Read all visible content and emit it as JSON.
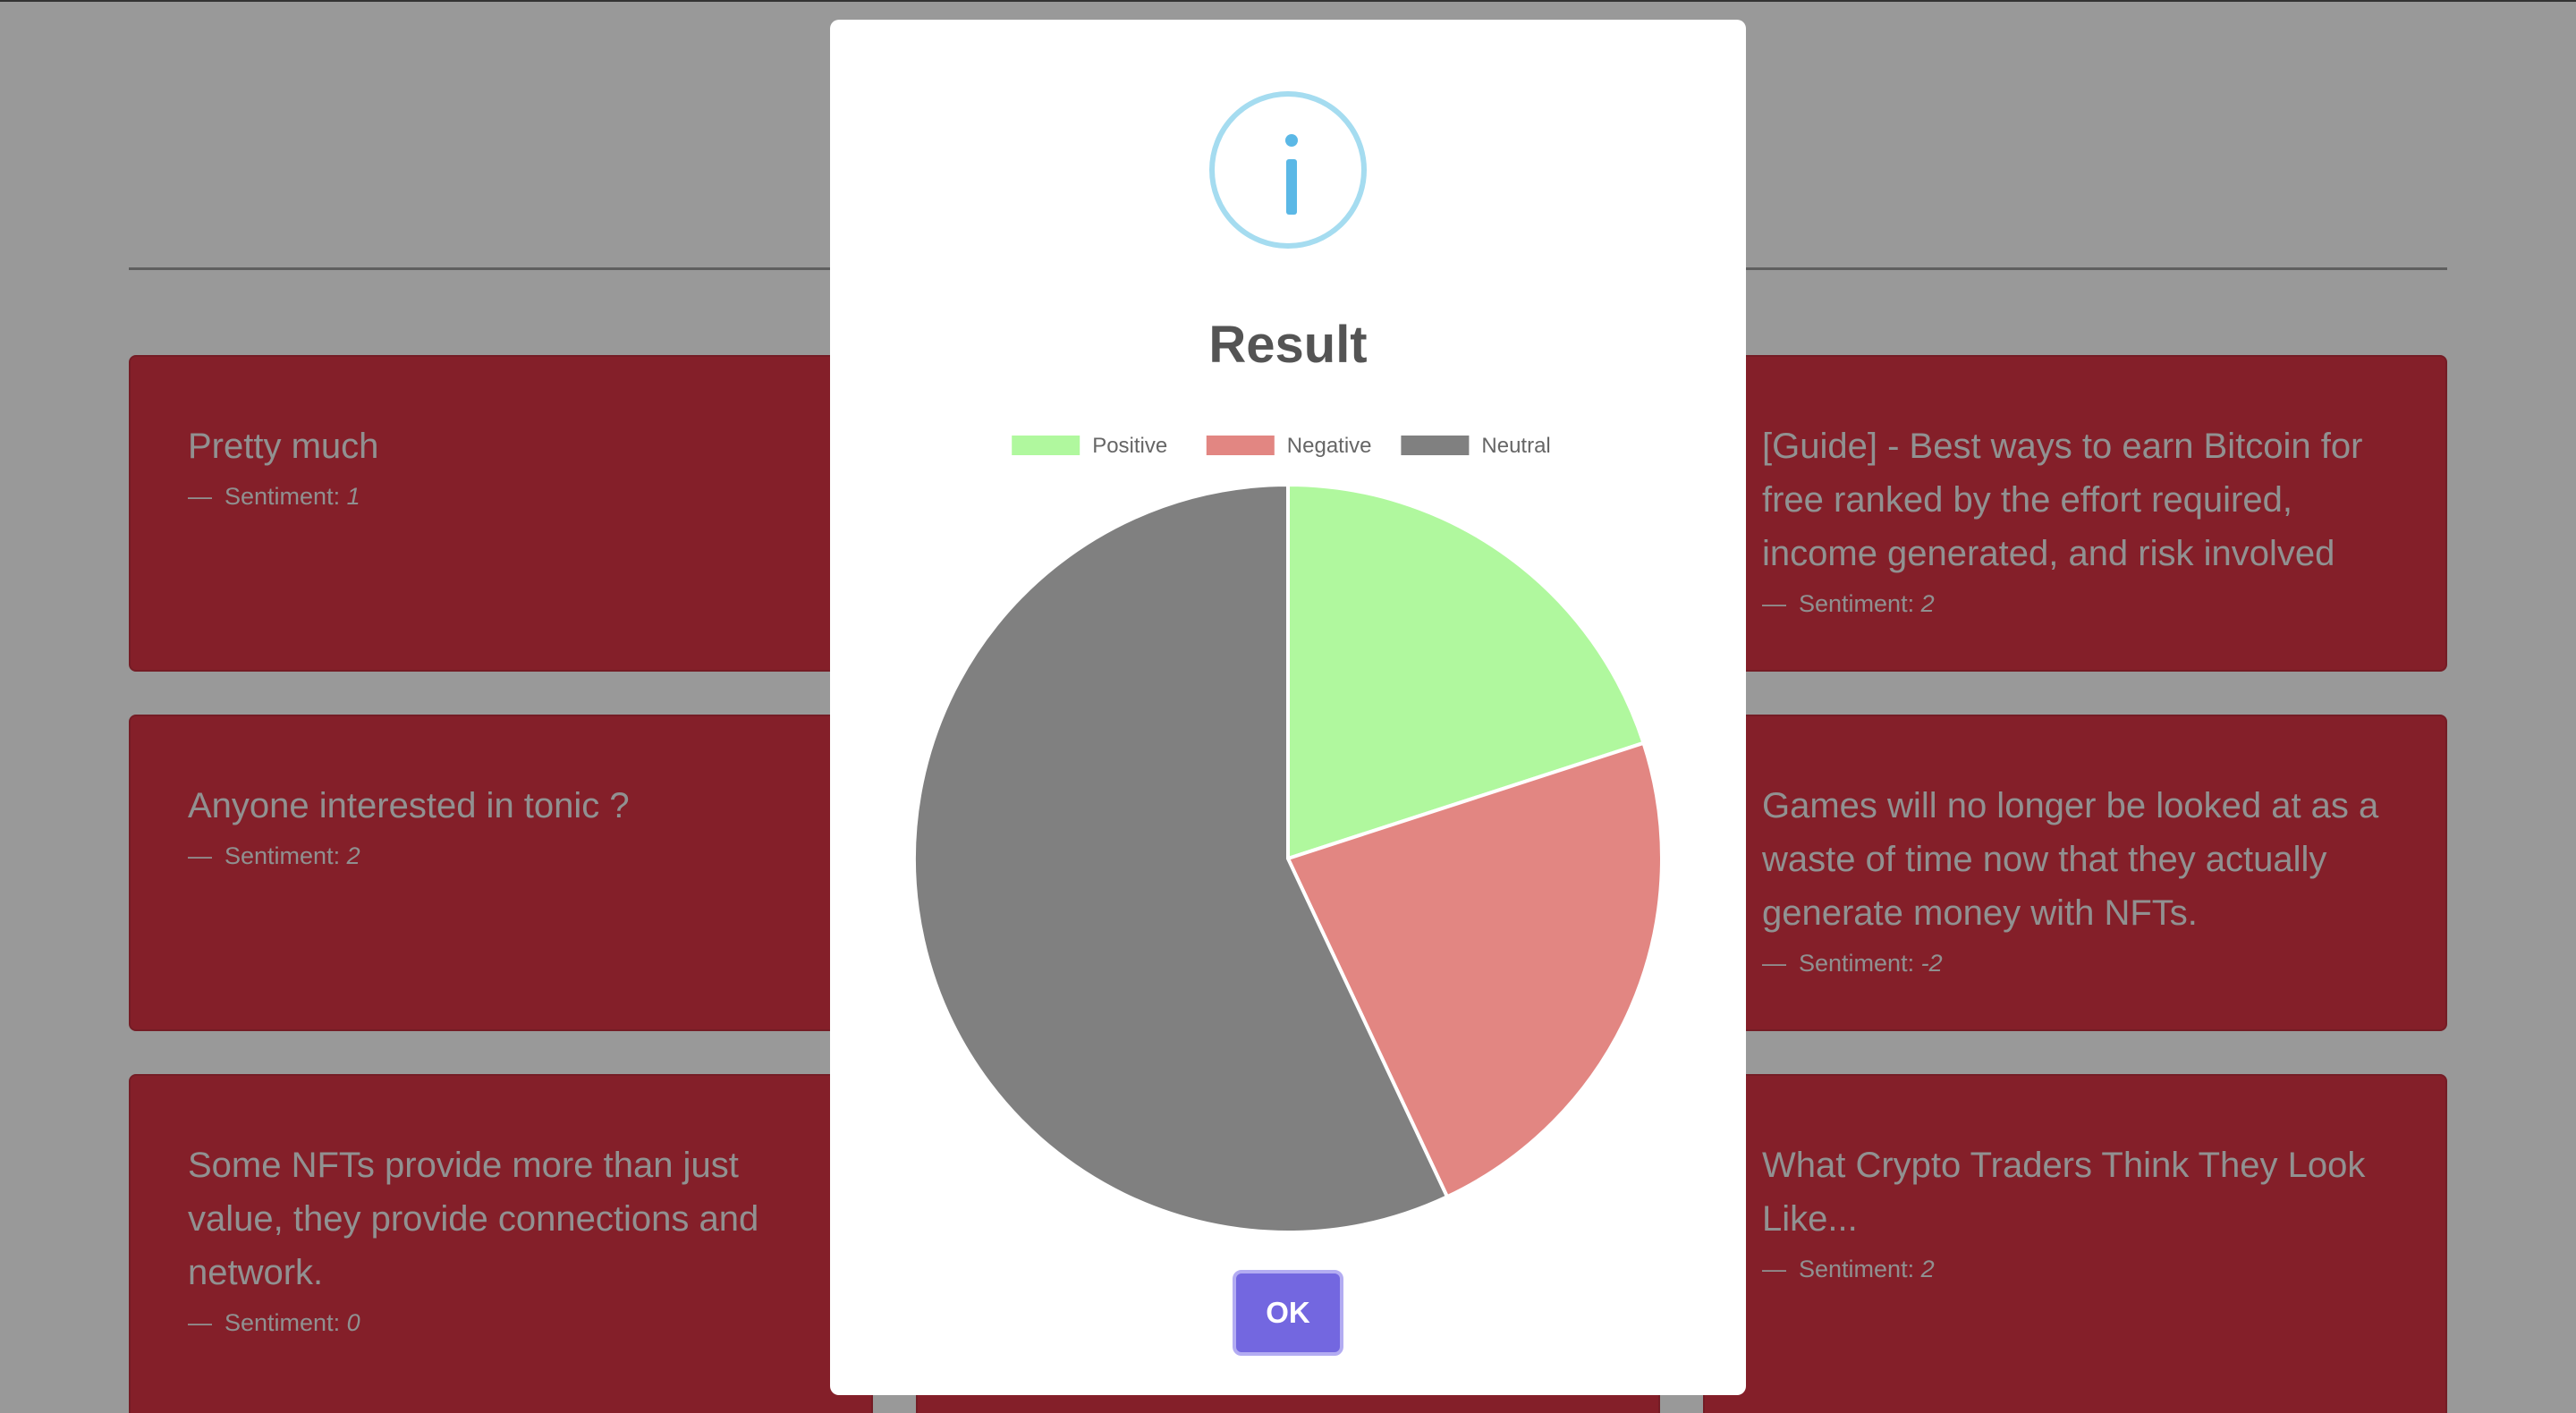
{
  "cards": [
    {
      "title": "Pretty much",
      "sentiment_label": "Sentiment:",
      "sentiment": "1"
    },
    {
      "title": "[Guide] - Best ways to earn Bitcoin for free ranked by the effort required, income generated, and risk involved",
      "sentiment_label": "Sentiment:",
      "sentiment": "2"
    },
    {
      "title": "Anyone interested in tonic ?",
      "sentiment_label": "Sentiment:",
      "sentiment": "2"
    },
    {
      "title": "Games will no longer be looked at as a waste of time now that they actually generate money with NFTs.",
      "sentiment_label": "Sentiment:",
      "sentiment": "-2"
    },
    {
      "title": "Some NFTs provide more than just value, they provide connections and network.",
      "sentiment_label": "Sentiment:",
      "sentiment": "0"
    },
    {
      "title": "What Crypto Traders Think They Look Like...",
      "sentiment_label": "Sentiment:",
      "sentiment": "2"
    }
  ],
  "dialog": {
    "icon": "info-icon",
    "title": "Result",
    "ok_label": "OK"
  },
  "chart_data": {
    "type": "pie",
    "categories": [
      "Positive",
      "Negative",
      "Neutral"
    ],
    "values": [
      20,
      23,
      57
    ],
    "colors": [
      "#b0f89e",
      "#e28682",
      "#808080"
    ],
    "legend": "top",
    "start_angle": "top, clockwise"
  },
  "colors": {
    "card_bg": "#dc3545",
    "ok_button": "#7367e0",
    "info_icon": "#5bb8e6"
  }
}
